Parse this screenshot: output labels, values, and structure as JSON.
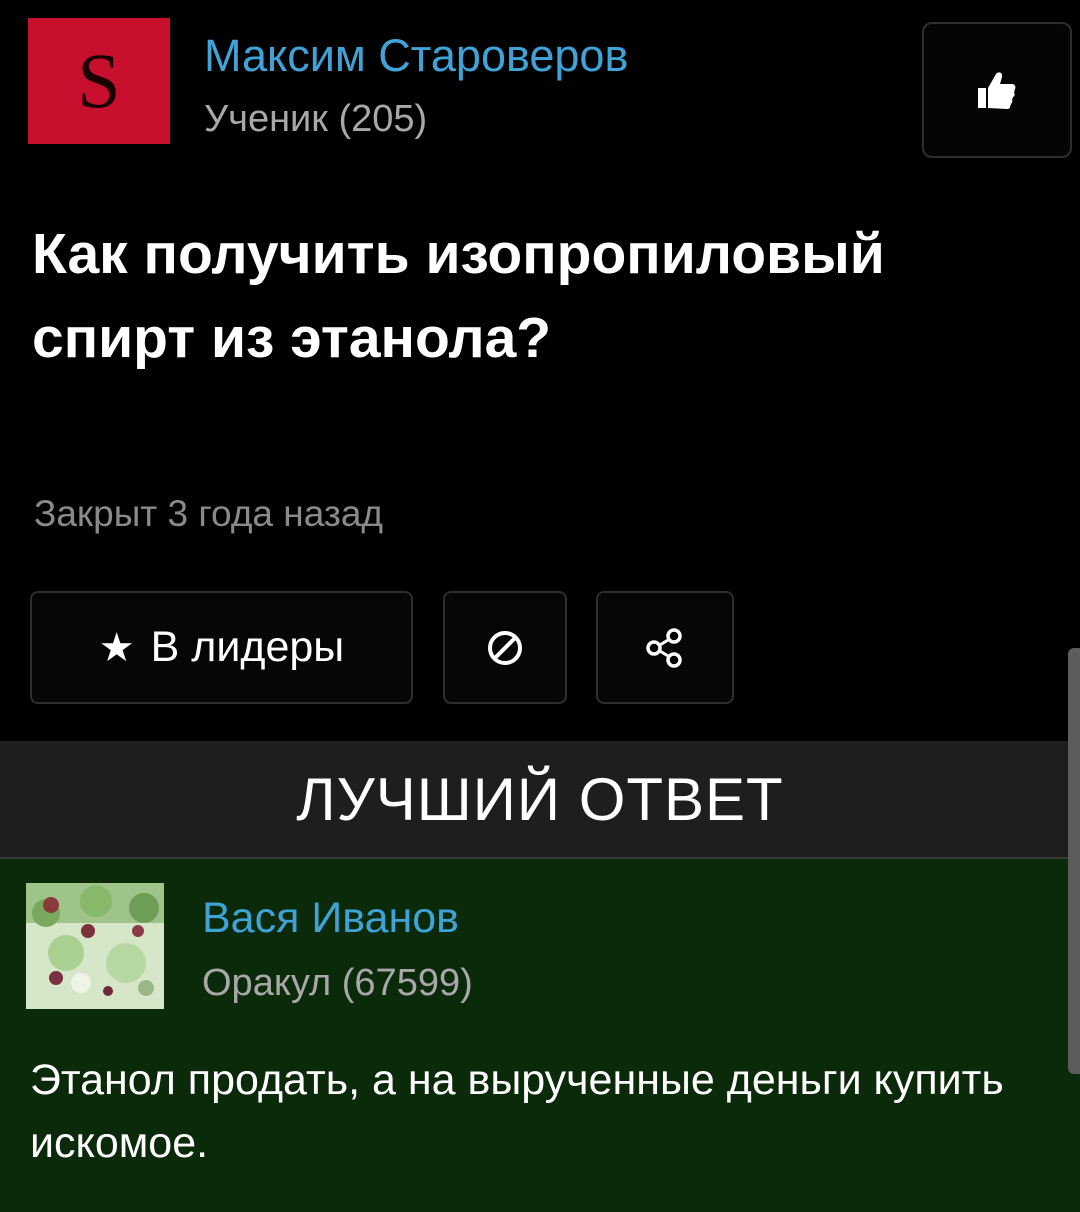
{
  "question": {
    "author": {
      "avatar_letter": "S",
      "name": "Максим Староверов",
      "rank": "Ученик (205)"
    },
    "title": "Как получить изопропиловый спирт из этанола?",
    "status": "Закрыт 3 года назад",
    "actions": {
      "leaders_label": "В лидеры",
      "leaders_icon": "star-icon",
      "block_icon": "block-icon",
      "share_icon": "share-icon",
      "like_icon": "thumbs-up-icon"
    }
  },
  "best_answer": {
    "header": "ЛУЧШИЙ ОТВЕТ",
    "author": {
      "name": "Вася Иванов",
      "rank": "Оракул (67599)"
    },
    "text": "Этанол продать, а на вырученные деньги купить искомое."
  },
  "colors": {
    "background": "#000000",
    "link_blue": "#3fa3d8",
    "avatar_red": "#c8102e",
    "answer_green": "#0a2a0a",
    "header_gray": "#1e1e1e"
  }
}
